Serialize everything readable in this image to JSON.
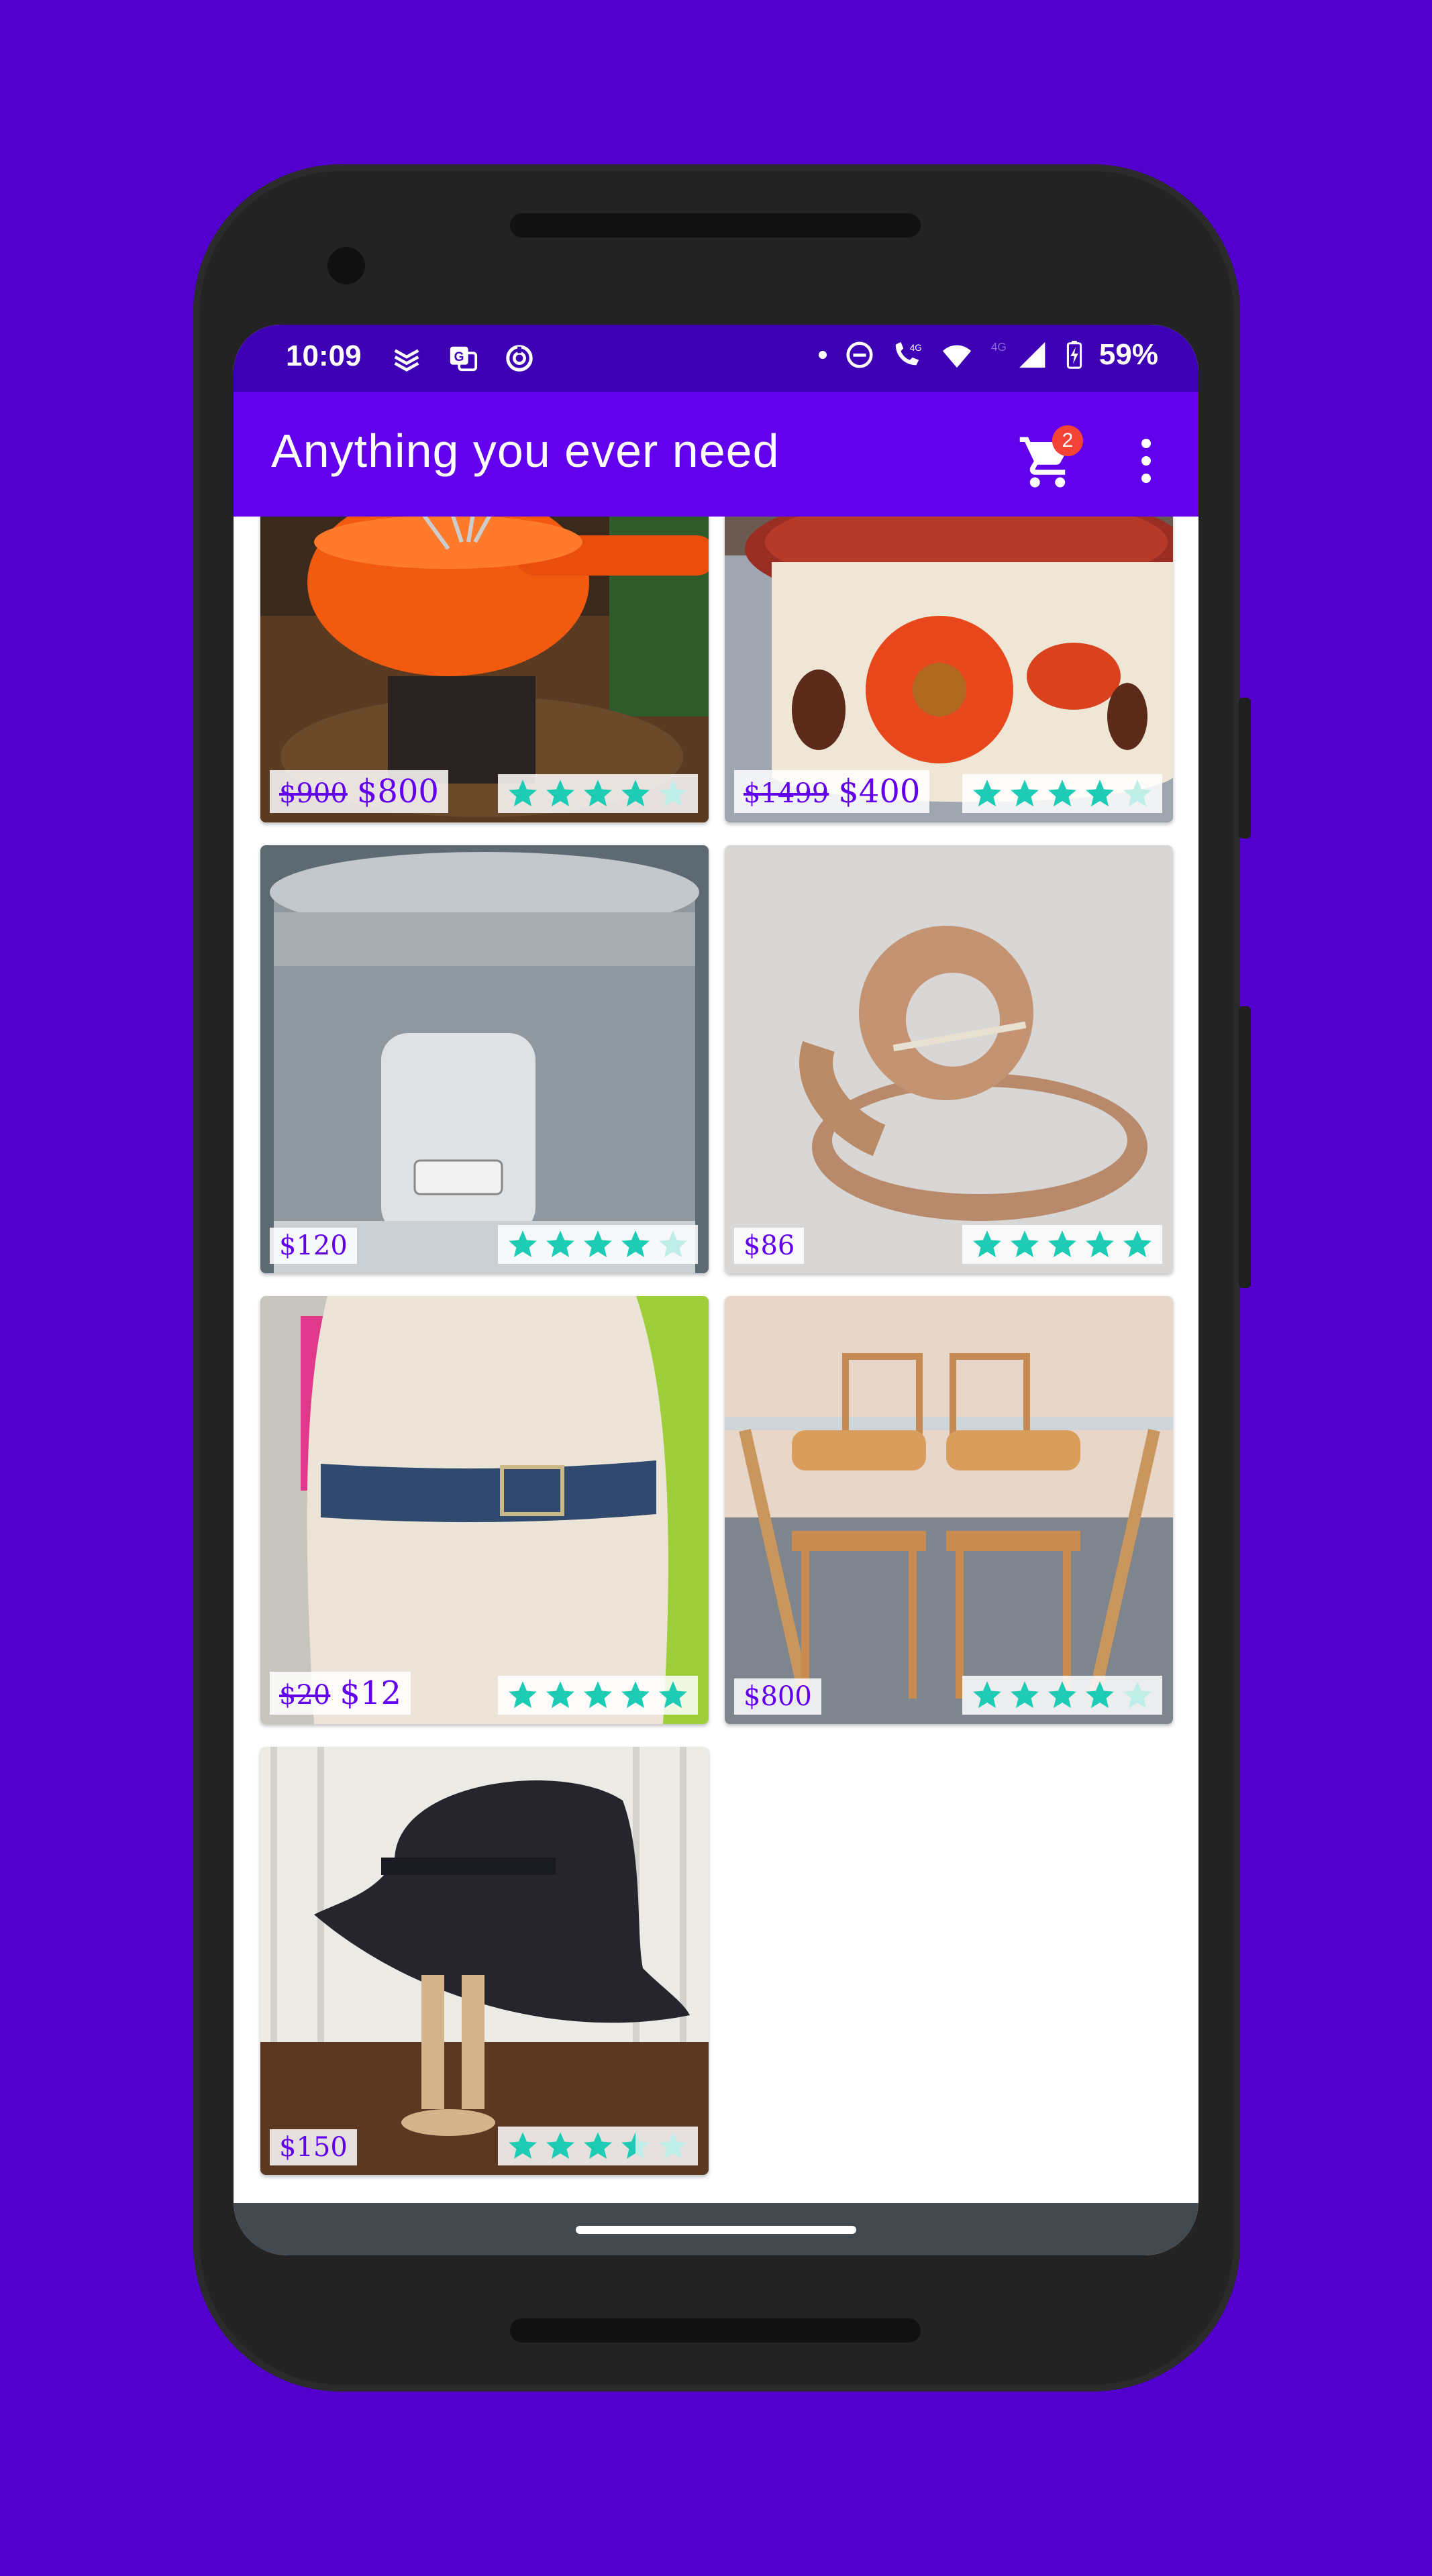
{
  "status_bar": {
    "time": "10:09",
    "battery": "59%",
    "icons": [
      "maps-directions-icon",
      "translate-icon",
      "data-saver-icon",
      "dot-icon",
      "dnd-icon",
      "volte-call-icon",
      "wifi-icon",
      "signal-4g-icon",
      "battery-charging-icon"
    ]
  },
  "app_bar": {
    "title": "Anything you ever need",
    "cart_badge": "2",
    "cart_icon": "shopping-cart-icon",
    "menu_icon": "more-vert-icon"
  },
  "colors": {
    "background": "#5300cf",
    "app_bar": "#6200ee",
    "status_bar": "#3d00b4",
    "price": "#6200ee",
    "star": "#1ecbb4",
    "badge": "#f44336"
  },
  "products": [
    {
      "name": "fondue-set",
      "old_price": "$900",
      "price": "$800",
      "rating": 4
    },
    {
      "name": "floral-pot",
      "old_price": "$1499",
      "price": "$400",
      "rating": 4
    },
    {
      "name": "rice-cooker",
      "old_price": "",
      "price": "$120",
      "rating": 4
    },
    {
      "name": "suede-belt",
      "old_price": "",
      "price": "$86",
      "rating": 5
    },
    {
      "name": "denim-belt",
      "old_price": "$20",
      "price": "$12",
      "rating": 5
    },
    {
      "name": "dining-chairs",
      "old_price": "",
      "price": "$800",
      "rating": 4
    },
    {
      "name": "felt-hat",
      "old_price": "",
      "price": "$150",
      "rating": 3.5
    }
  ]
}
